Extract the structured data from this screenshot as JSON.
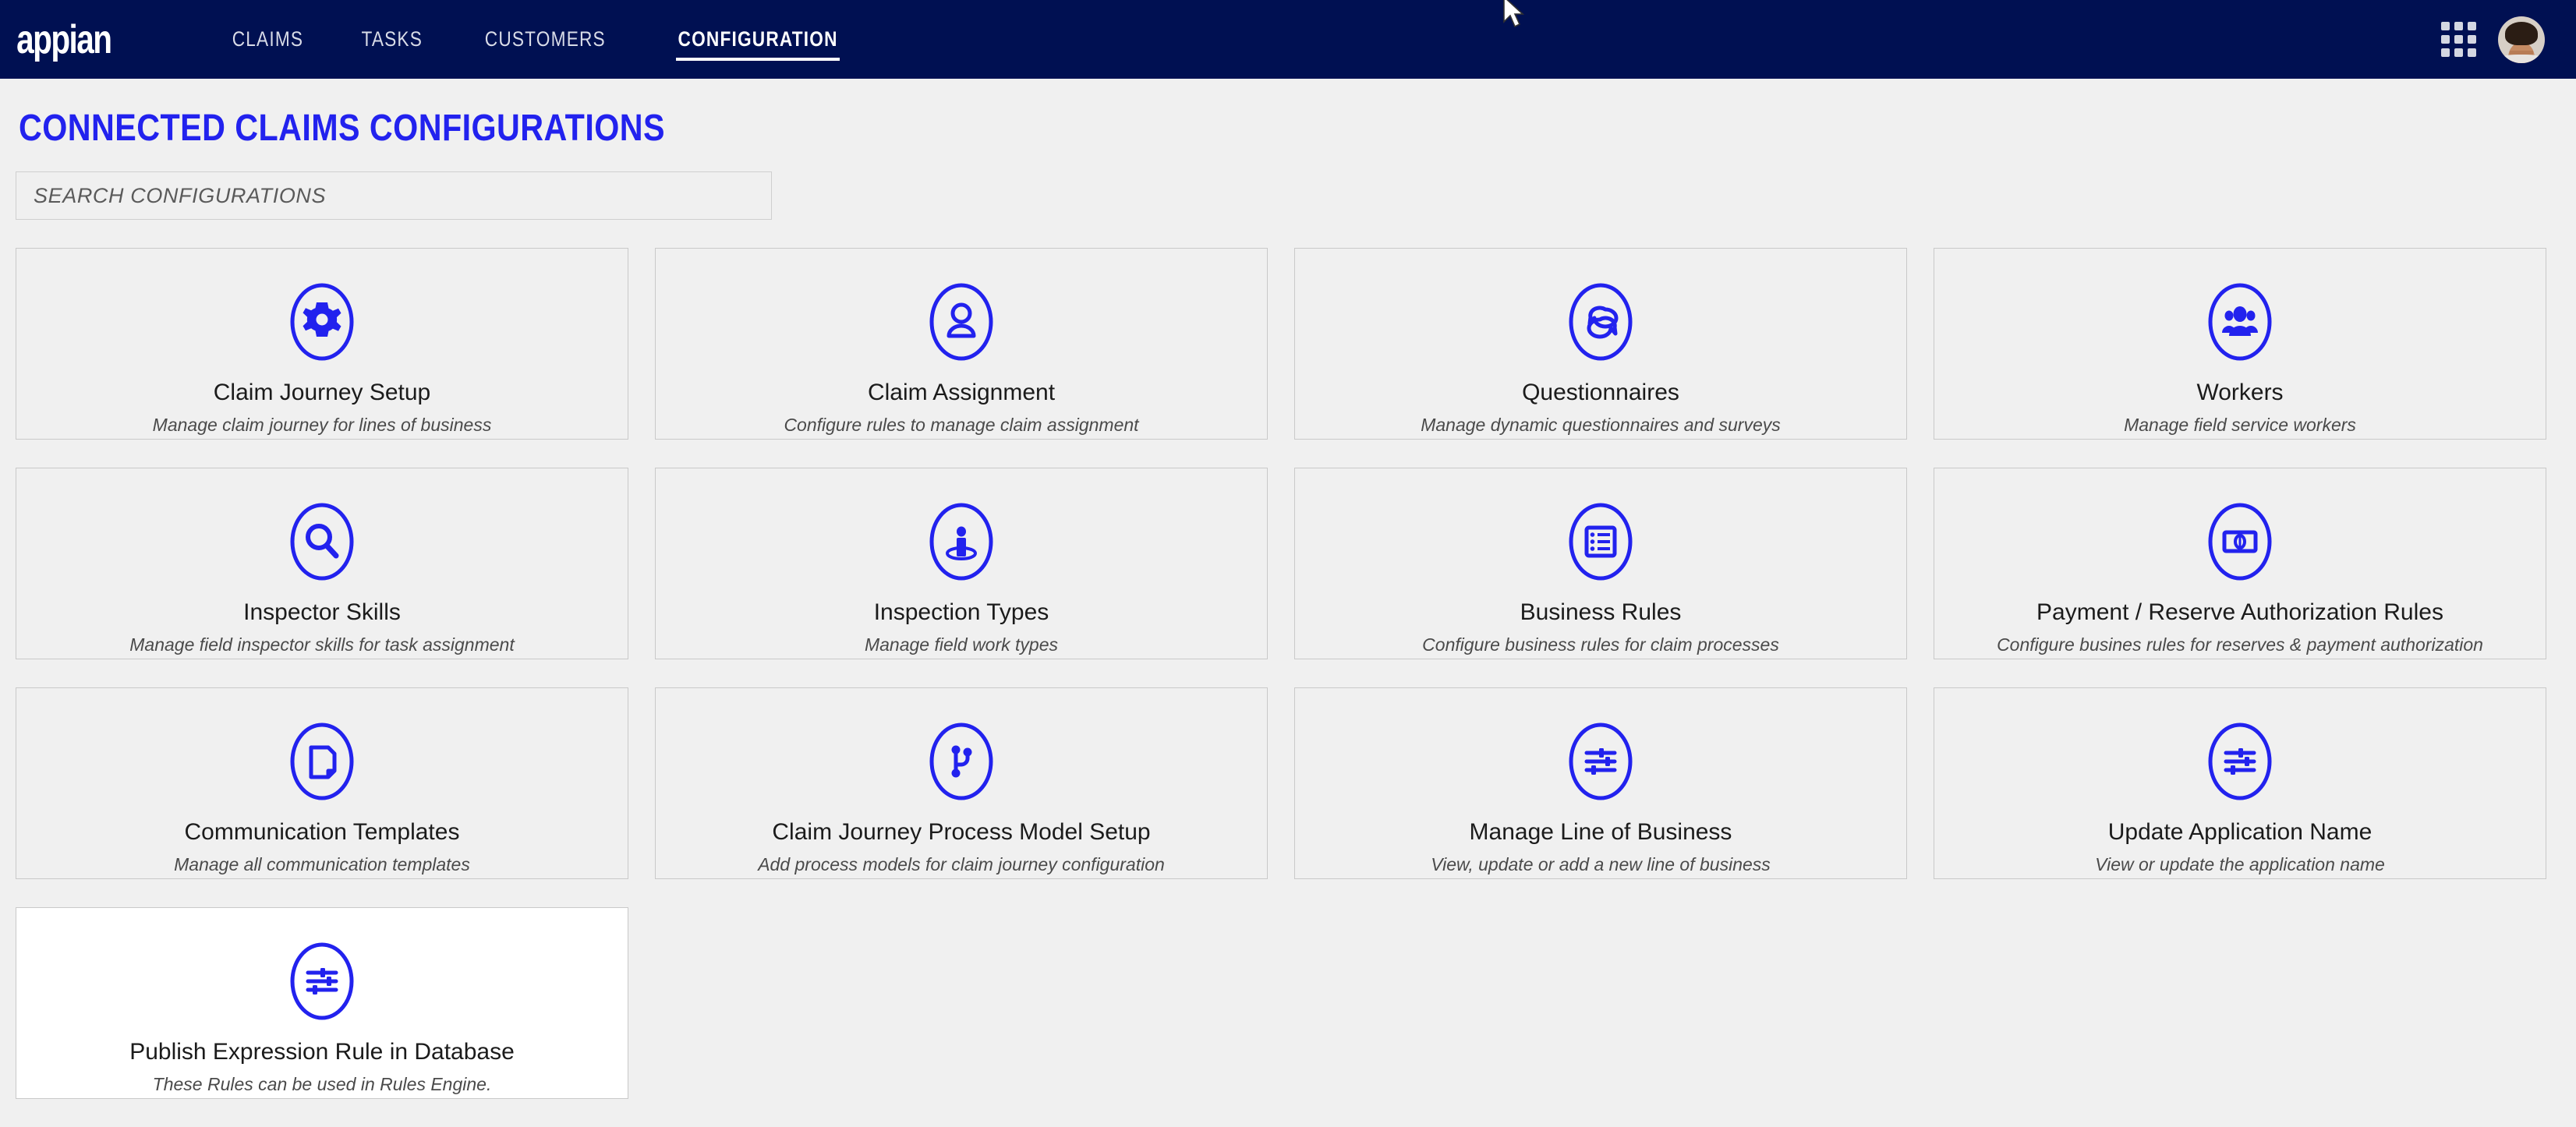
{
  "header": {
    "logo": "appian",
    "nav": [
      {
        "label": "CLAIMS",
        "active": false
      },
      {
        "label": "TASKS",
        "active": false
      },
      {
        "label": "CUSTOMERS",
        "active": false
      },
      {
        "label": "CONFIGURATION",
        "active": true
      }
    ],
    "apps_icon": "apps-grid-icon",
    "avatar_alt": "user-avatar"
  },
  "page": {
    "title": "CONNECTED CLAIMS CONFIGURATIONS",
    "search_placeholder": "SEARCH CONFIGURATIONS",
    "search_value": ""
  },
  "colors": {
    "header_bg": "#001052",
    "accent_blue": "#2222ee",
    "page_bg": "#f0f0f0",
    "card_border": "#c9c9c9",
    "card_hover_bg": "#ffffff"
  },
  "cards": [
    {
      "icon": "gear-icon",
      "title": "Claim Journey Setup",
      "desc": "Manage claim journey for lines of business",
      "hovered": false
    },
    {
      "icon": "user-icon",
      "title": "Claim Assignment",
      "desc": "Configure rules to manage claim assignment",
      "hovered": false
    },
    {
      "icon": "chat-bubbles-icon",
      "title": "Questionnaires",
      "desc": "Manage dynamic questionnaires and surveys",
      "hovered": false
    },
    {
      "icon": "group-people-icon",
      "title": "Workers",
      "desc": "Manage field service workers",
      "hovered": false
    },
    {
      "icon": "magnifier-icon",
      "title": "Inspector Skills",
      "desc": "Manage field inspector skills for task assignment",
      "hovered": false
    },
    {
      "icon": "person-location-icon",
      "title": "Inspection Types",
      "desc": "Manage field work types",
      "hovered": false
    },
    {
      "icon": "checklist-icon",
      "title": "Business Rules",
      "desc": "Configure business rules for claim processes",
      "hovered": false
    },
    {
      "icon": "banknote-icon",
      "title": "Payment / Reserve Authorization Rules",
      "desc": "Configure busines rules for reserves & payment authorization",
      "hovered": false
    },
    {
      "icon": "document-icon",
      "title": "Communication Templates",
      "desc": "Manage all communication templates",
      "hovered": false
    },
    {
      "icon": "branch-icon",
      "title": "Claim Journey Process Model Setup",
      "desc": "Add process models for claim journey configuration",
      "hovered": false
    },
    {
      "icon": "sliders-icon",
      "title": "Manage Line of Business",
      "desc": "View, update or add a new line of business",
      "hovered": false
    },
    {
      "icon": "sliders-icon",
      "title": "Update Application Name",
      "desc": "View or update the application name",
      "hovered": false
    },
    {
      "icon": "sliders-icon",
      "title": "Publish Expression Rule in Database",
      "desc": "These Rules can be used in Rules Engine.",
      "hovered": true
    }
  ]
}
